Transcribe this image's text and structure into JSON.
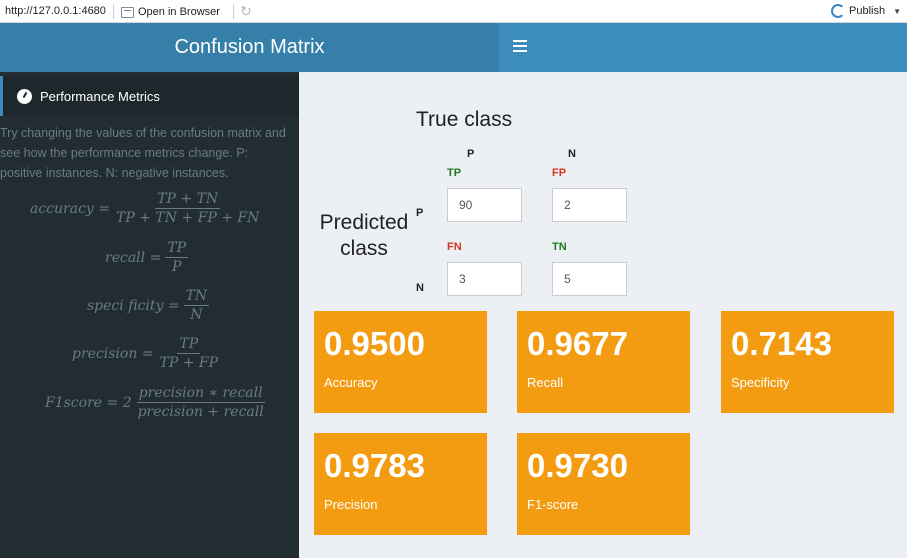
{
  "viewer": {
    "url": "http://127.0.0.1:4680",
    "open_label": "Open in Browser",
    "publish_label": "Publish"
  },
  "header": {
    "title": "Confusion Matrix"
  },
  "sidebar": {
    "menu_label": "Performance Metrics",
    "description": "Try changing the values of the confusion matrix and see how the performance metrics change. P: positive instances. N: negative instances.",
    "formulas": {
      "accuracy": {
        "lhs": "accuracy =",
        "num": "TP + TN",
        "den": "TP + TN + FP + FN"
      },
      "recall": {
        "lhs": "recall =",
        "num": "TP",
        "den": "P"
      },
      "specificity": {
        "lhs": "speci ficity =",
        "num": "TN",
        "den": "N"
      },
      "precision": {
        "lhs": "precision =",
        "num": "TP",
        "den": "TP + FP"
      },
      "f1": {
        "lhs": "F1score = 2",
        "num": "precision ∗ recall",
        "den": "precision + recall"
      }
    }
  },
  "matrix": {
    "true_class_label": "True class",
    "predicted_class_label": "Predicted class",
    "col_p": "P",
    "col_n": "N",
    "row_p": "P",
    "row_n": "N",
    "tp_label": "TP",
    "fp_label": "FP",
    "fn_label": "FN",
    "tn_label": "TN",
    "tp": "90",
    "fp": "2",
    "fn": "3",
    "tn": "5"
  },
  "metrics": [
    {
      "value": "0.9500",
      "label": "Accuracy"
    },
    {
      "value": "0.9677",
      "label": "Recall"
    },
    {
      "value": "0.7143",
      "label": "Specificity"
    },
    {
      "value": "0.9783",
      "label": "Precision"
    },
    {
      "value": "0.9730",
      "label": "F1-score"
    }
  ],
  "colors": {
    "header": "#3c8dbc",
    "logo": "#367fa9",
    "sidebar": "#222d32",
    "value_box": "#f39c12",
    "tp_tn_label": "#1c7a1c",
    "fp_fn_label": "#d9351b"
  }
}
